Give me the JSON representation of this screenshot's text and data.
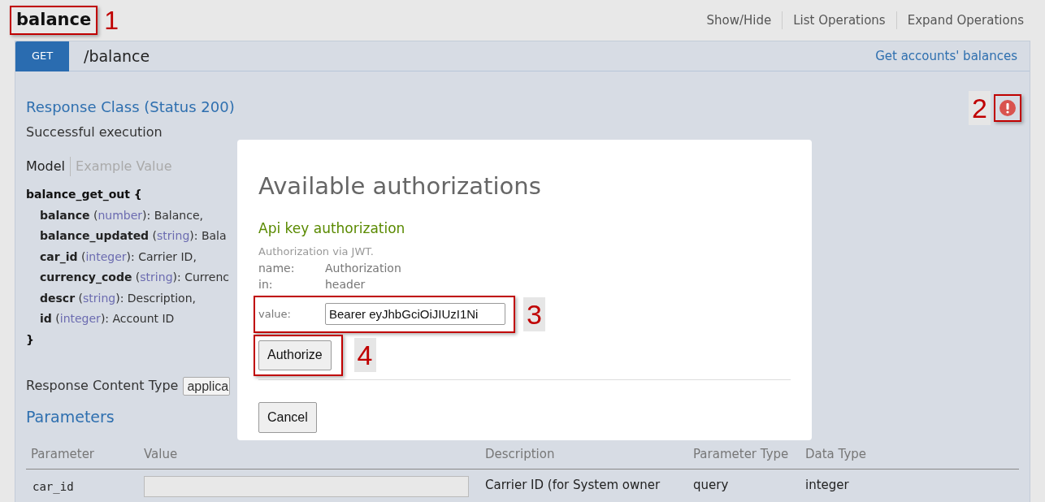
{
  "header": {
    "title": "balance",
    "callout": "1",
    "links": [
      "Show/Hide",
      "List Operations",
      "Expand Operations"
    ]
  },
  "operation": {
    "method": "GET",
    "path": "/balance",
    "summary": "Get accounts' balances",
    "alert_callout": "2"
  },
  "response": {
    "title": "Response Class (Status 200)",
    "description": "Successful execution",
    "tabs": [
      {
        "label": "Model",
        "selected": true
      },
      {
        "label": "Example Value",
        "selected": false
      }
    ],
    "model": {
      "name": "balance_get_out {",
      "close": "}",
      "fields": [
        {
          "name": "balance",
          "open": "(",
          "type": "number",
          "desc": "): Balance,"
        },
        {
          "name": "balance_updated",
          "open": "(",
          "type": "string",
          "desc": "): Bala"
        },
        {
          "name": "car_id",
          "open": "(",
          "type": "integer",
          "desc": "): Carrier ID,"
        },
        {
          "name": "currency_code",
          "open": "(",
          "type": "string",
          "desc": "): Currenc"
        },
        {
          "name": "descr",
          "open": "(",
          "type": "string",
          "desc": "): Description,"
        },
        {
          "name": "id",
          "open": "(",
          "type": "integer",
          "desc": "): Account ID"
        }
      ]
    }
  },
  "content_type": {
    "label": "Response Content Type",
    "value": "applica"
  },
  "parameters": {
    "title": "Parameters",
    "columns": [
      "Parameter",
      "Value",
      "Description",
      "Parameter Type",
      "Data Type"
    ],
    "rows": [
      {
        "parameter": "car_id",
        "description": "Carrier ID (for System owner",
        "parameter_type": "query",
        "data_type": "integer"
      }
    ]
  },
  "modal": {
    "title": "Available authorizations",
    "auth_title": "Api key authorization",
    "auth_note": "Authorization via JWT.",
    "props": [
      {
        "label": "name:",
        "value": "Authorization"
      },
      {
        "label": "in:",
        "value": "header"
      }
    ],
    "value_label": "value:",
    "value": "Bearer eyJhbGciOiJIUzI1Ni",
    "value_callout": "3",
    "authorize": "Authorize",
    "authorize_callout": "4",
    "cancel": "Cancel"
  }
}
